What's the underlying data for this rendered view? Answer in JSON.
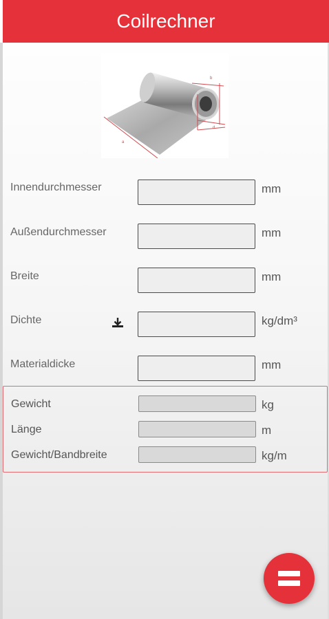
{
  "header": {
    "title": "Coilrechner"
  },
  "image": {
    "name": "coil-diagram",
    "labels": [
      "a",
      "b",
      "d"
    ]
  },
  "inputs": [
    {
      "label": "Innendurchmesser",
      "value": "",
      "unit": "mm"
    },
    {
      "label": "Außendurchmesser",
      "value": "",
      "unit": "mm"
    },
    {
      "label": "Breite",
      "value": "",
      "unit": "mm"
    },
    {
      "label": "Dichte",
      "value": "",
      "unit": "kg/dm³",
      "icon": "download-icon"
    },
    {
      "label": "Materialdicke",
      "value": "",
      "unit": "mm"
    }
  ],
  "results": [
    {
      "label": "Gewicht",
      "value": "",
      "unit": "kg"
    },
    {
      "label": "Länge",
      "value": "",
      "unit": "m"
    },
    {
      "label": "Gewicht/Bandbreite",
      "value": "",
      "unit": "kg/m"
    }
  ],
  "fab": {
    "icon": "equals-icon"
  },
  "colors": {
    "accent": "#e5323a",
    "result_border": "#e06b70"
  }
}
